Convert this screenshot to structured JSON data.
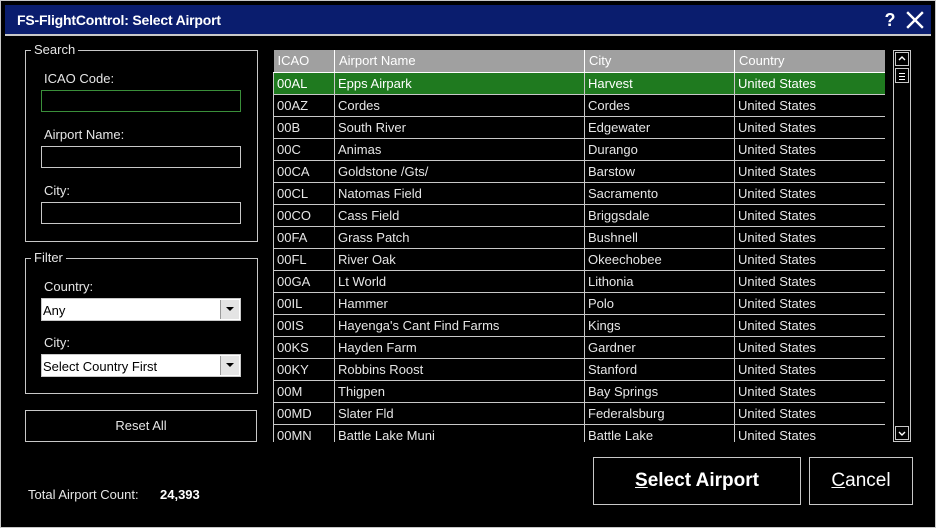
{
  "window": {
    "title": "FS-FlightControl: Select Airport",
    "help_glyph": "?"
  },
  "search": {
    "legend": "Search",
    "icao_label": "ICAO Code:",
    "icao_value": "",
    "name_label": "Airport Name:",
    "name_value": "",
    "city_label": "City:",
    "city_value": ""
  },
  "filter": {
    "legend": "Filter",
    "country_label": "Country:",
    "country_value": "Any",
    "city_label": "City:",
    "city_value": "Select Country First"
  },
  "reset_label": "Reset All",
  "total": {
    "label": "Total Airport Count:",
    "value": "24,393"
  },
  "buttons": {
    "select_mnemonic": "S",
    "select_rest": "elect Airport",
    "cancel_mnemonic": "C",
    "cancel_rest": "ancel"
  },
  "table": {
    "columns": [
      "ICAO",
      "Airport Name",
      "City",
      "Country"
    ],
    "selected_index": 0,
    "rows": [
      [
        "00AL",
        "Epps Airpark",
        "Harvest",
        "United States"
      ],
      [
        "00AZ",
        "Cordes",
        "Cordes",
        "United States"
      ],
      [
        "00B",
        "South River",
        "Edgewater",
        "United States"
      ],
      [
        "00C",
        "Animas",
        "Durango",
        "United States"
      ],
      [
        "00CA",
        "Goldstone /Gts/",
        "Barstow",
        "United States"
      ],
      [
        "00CL",
        "Natomas Field",
        "Sacramento",
        "United States"
      ],
      [
        "00CO",
        "Cass Field",
        "Briggsdale",
        "United States"
      ],
      [
        "00FA",
        "Grass Patch",
        "Bushnell",
        "United States"
      ],
      [
        "00FL",
        "River Oak",
        "Okeechobee",
        "United States"
      ],
      [
        "00GA",
        "Lt World",
        "Lithonia",
        "United States"
      ],
      [
        "00IL",
        "Hammer",
        "Polo",
        "United States"
      ],
      [
        "00IS",
        "Hayenga's Cant Find Farms",
        "Kings",
        "United States"
      ],
      [
        "00KS",
        "Hayden Farm",
        "Gardner",
        "United States"
      ],
      [
        "00KY",
        "Robbins Roost",
        "Stanford",
        "United States"
      ],
      [
        "00M",
        "Thigpen",
        "Bay Springs",
        "United States"
      ],
      [
        "00MD",
        "Slater Fld",
        "Federalsburg",
        "United States"
      ],
      [
        "00MN",
        "Battle Lake Muni",
        "Battle Lake",
        "United States"
      ]
    ]
  },
  "colors": {
    "title_bar": "#0a1d6e",
    "selection": "#1f7a1f",
    "header": "#a0a0a0"
  }
}
